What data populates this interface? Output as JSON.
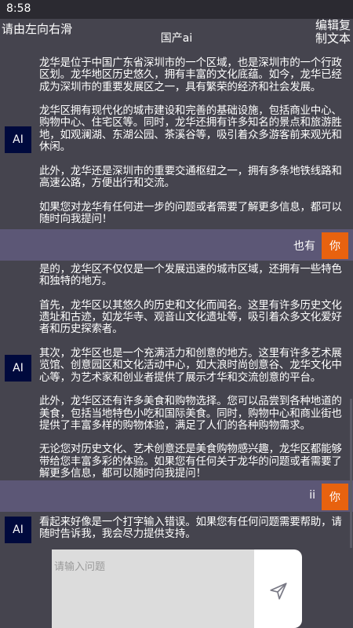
{
  "status": {
    "time": "8:58"
  },
  "topbar": {
    "hint": "请由左向右滑",
    "title": "国产ai",
    "edit_copy": "编辑复制文本"
  },
  "messages": [
    {
      "role": "ai",
      "avatar": "AI",
      "text": "龙华是位于中国广东省深圳市的一个区域，也是深圳市的一个行政区划。龙华地区历史悠久，拥有丰富的文化底蕴。如今，龙华已经成为深圳市的重要发展区之一，具有繁荣的经济和社会发展。\n\n龙华区拥有现代化的城市建设和完善的基础设施，包括商业中心、购物中心、住宅区等。同时，龙华还拥有许多知名的景点和旅游胜地，如观澜湖、东湖公园、茶溪谷等，吸引着众多游客前来观光和休闲。\n\n此外，龙华还是深圳市的重要交通枢纽之一，拥有多条地铁线路和高速公路，方便出行和交流。\n\n如果您对龙华有任何进一步的问题或者需要了解更多信息，都可以随时向我提问！"
    },
    {
      "role": "user",
      "avatar": "你",
      "text": "也有"
    },
    {
      "role": "ai",
      "avatar": "AI",
      "text": "是的，龙华区不仅仅是一个发展迅速的城市区域，还拥有一些特色和独特的地方。\n\n首先，龙华区以其悠久的历史和文化而闻名。这里有许多历史文化遗址和古迹，如龙华寺、观音山文化遗址等，吸引着众多文化爱好者和历史探索者。\n\n其次，龙华区也是一个充满活力和创意的地方。这里有许多艺术展览馆、创意园区和文化活动中心，如大浪时尚创意谷、龙华文化中心等，为艺术家和创业者提供了展示才华和交流创意的平台。\n\n此外，龙华区还有许多美食和购物选择。您可以品尝到各种地道的美食，包括当地特色小吃和国际美食。同时，购物中心和商业街也提供了丰富多样的购物体验，满足了人们的各种购物需求。\n\n无论您对历史文化、艺术创意还是美食购物感兴趣，龙华区都能够带给您丰富多彩的体验。如果您有任何关于龙华的问题或者需要了解更多信息，都可以随时向我提问！"
    },
    {
      "role": "user",
      "avatar": "你",
      "text": "ii"
    },
    {
      "role": "ai",
      "avatar": "AI",
      "text": "看起来好像是一个打字输入错误。如果您有任何问题需要帮助，请随时告诉我，我会尽力提供支持。"
    }
  ],
  "input": {
    "placeholder": "请输入问题",
    "send_icon": "send-icon"
  },
  "colors": {
    "background": "#45444e",
    "user_row": "#5c5776",
    "ai_avatar": "#000a3d",
    "user_avatar": "#e8620f"
  }
}
